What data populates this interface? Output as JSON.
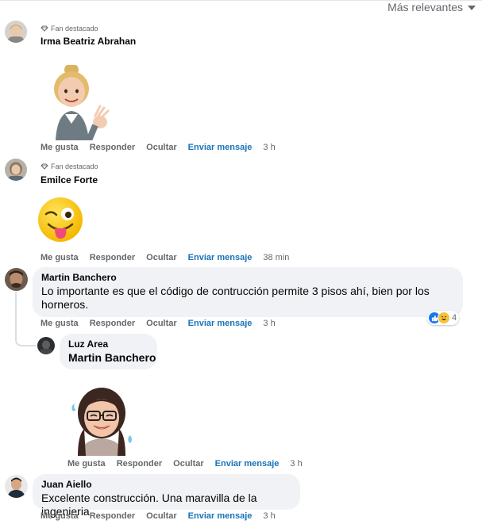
{
  "header": {
    "sort_label": "Más relevantes"
  },
  "actions": {
    "like": "Me gusta",
    "reply": "Responder",
    "hide": "Ocultar",
    "message": "Enviar mensaje"
  },
  "comments": [
    {
      "badge": "Fan destacado",
      "author": "Irma Beatriz Abrahan",
      "time": "3 h"
    },
    {
      "badge": "Fan destacado",
      "author": "Emilce Forte",
      "time": "38 min"
    },
    {
      "author": "Martin Banchero",
      "text": "Lo importante es que el código de contrucción permite 3 pisos ahí, bien por los horneros.",
      "time": "3 h",
      "reaction_count": "4"
    },
    {
      "author": "Luz Area",
      "text": "Martin Banchero",
      "time": "3 h"
    },
    {
      "author": "Juan Aiello",
      "text": "Excelente construcción. Una maravilla de la ingenieria",
      "time": "3 h"
    }
  ],
  "colors": {
    "link_blue": "#1a73b7",
    "muted": "#65676b",
    "bubble": "#f0f2f5"
  }
}
